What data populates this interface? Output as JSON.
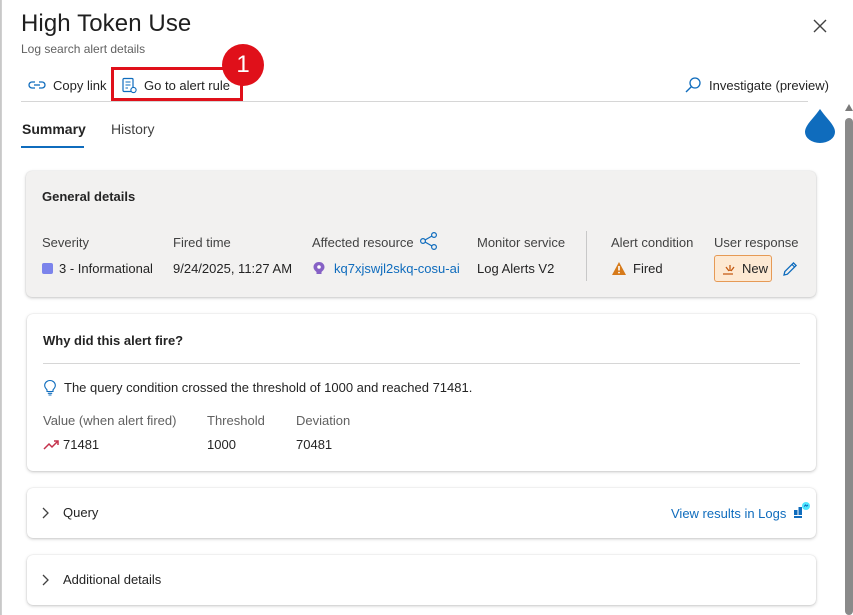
{
  "header": {
    "title": "High Token Use",
    "subtitle": "Log search alert details"
  },
  "toolbar": {
    "copy_link": "Copy link",
    "go_to_alert_rule": "Go to alert rule",
    "investigate": "Investigate (preview)"
  },
  "callout": {
    "number": "1"
  },
  "tabs": [
    {
      "label": "Summary",
      "selected": true
    },
    {
      "label": "History",
      "selected": false
    }
  ],
  "general": {
    "title": "General details",
    "severity": {
      "label": "Severity",
      "value": "3 - Informational",
      "color": "#7b83eb"
    },
    "fired_time": {
      "label": "Fired time",
      "value": "9/24/2025, 11:27 AM"
    },
    "affected_resource": {
      "label": "Affected resource",
      "value": "kq7xjswjl2skq-cosu-ai"
    },
    "monitor_service": {
      "label": "Monitor service",
      "value": "Log Alerts V2"
    },
    "alert_condition": {
      "label": "Alert condition",
      "value": "Fired"
    },
    "user_response": {
      "label": "User response",
      "value": "New"
    }
  },
  "why": {
    "title": "Why did this alert fire?",
    "message": "The query condition crossed the threshold of 1000 and reached 71481.",
    "metrics": [
      {
        "label": "Value (when alert fired)",
        "value": "71481"
      },
      {
        "label": "Threshold",
        "value": "1000"
      },
      {
        "label": "Deviation",
        "value": "70481"
      }
    ]
  },
  "query_section": {
    "label": "Query",
    "view_results": "View results in Logs"
  },
  "additional_section": {
    "label": "Additional details"
  },
  "colors": {
    "accent": "#0f6cbd",
    "highlight": "#e0101a",
    "warning": "#d67a1a",
    "trend": "#c4314b"
  }
}
